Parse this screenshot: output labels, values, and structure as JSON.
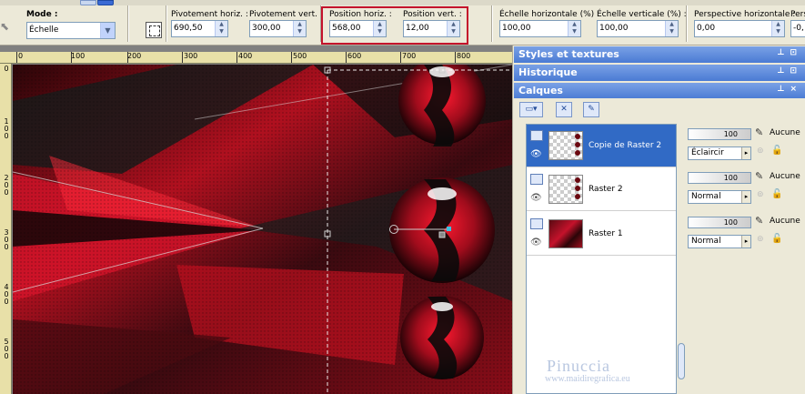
{
  "toolbar": {
    "mode_label": "Mode :",
    "mode_value": "Échelle",
    "pivot_h_label": "Pivotement horiz. :",
    "pivot_h_value": "690,50",
    "pivot_v_label": "Pivotement vert. :",
    "pivot_v_value": "300,00",
    "pos_h_label": "Position horiz. :",
    "pos_h_value": "568,00",
    "pos_v_label": "Position vert. :",
    "pos_v_value": "12,00",
    "scale_h_label": "Échelle horizontale (%) :",
    "scale_h_value": "100,00",
    "scale_v_label": "Échelle verticale (%) :",
    "scale_v_value": "100,00",
    "persp_h_label": "Perspective horizontale :",
    "persp_h_value": "0,00",
    "persp_v_label": "Pers",
    "persp_v_value": "-0,"
  },
  "ruler": {
    "h_labels": [
      "0",
      "100",
      "200",
      "300",
      "400",
      "500",
      "600",
      "700",
      "800"
    ],
    "v_labels": [
      "0",
      "1\n0\n0",
      "2\n0\n0",
      "3\n0\n0",
      "4\n0\n0",
      "5\n0\n0"
    ]
  },
  "panels": {
    "styles_title": "Styles et textures",
    "history_title": "Historique",
    "layers_title": "Calques"
  },
  "layers": [
    {
      "name": "Copie de Raster 2",
      "opacity": "100",
      "mask": "Aucune",
      "blend": "Éclaircir",
      "selected": true
    },
    {
      "name": "Raster 2",
      "opacity": "100",
      "mask": "Aucune",
      "blend": "Normal",
      "selected": false
    },
    {
      "name": "Raster 1",
      "opacity": "100",
      "mask": "Aucune",
      "blend": "Normal",
      "selected": false
    }
  ],
  "watermark": {
    "line1": "Pinuccia",
    "line2": "www.maidiregrafica.eu"
  },
  "colors": {
    "accent_red": "#c4122b",
    "title_blue": "#4a7bd4",
    "selection_blue": "#316ac5"
  }
}
